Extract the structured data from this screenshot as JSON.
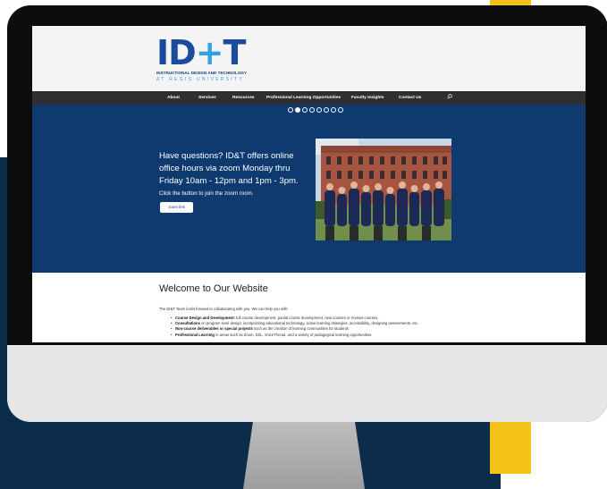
{
  "site": {
    "logo": {
      "mark_left": "ID",
      "mark_plus": "+",
      "mark_right": "T",
      "line1": "INSTRUCTIONAL DESIGN AND TECHNOLOGY",
      "line2": "AT REGIS UNIVERSITY"
    },
    "nav": {
      "items": [
        "About",
        "Services",
        "Resources",
        "Professional Learning Opportunities",
        "Faculty Insights",
        "Contact Us"
      ],
      "search_icon": "search-icon"
    },
    "hero": {
      "slide_count": 8,
      "active_slide": 2,
      "heading": "Have questions? ID&T offers online office hours via zoom Monday thru Friday 10am - 12pm and 1pm - 3pm.",
      "subtext": "Click the button to join the zoom room.",
      "button_label": "zoom link"
    },
    "content": {
      "title": "Welcome to Our Website",
      "intro": "The ID&T Team looks forward to collaborating with you. We can help you with:",
      "bullets": [
        {
          "bold": "Course Design and Development:",
          "text": " full course development, partial course development, new courses or revised courses."
        },
        {
          "bold": "Consultations",
          "text": " on program level design, incorporating educational technology, active learning strategies, accessibility, designing assessments, etc."
        },
        {
          "bold": "Non-course deliverables or special projects",
          "text": " such as the creation of learning communities for students"
        },
        {
          "bold": "Professional Learning",
          "text": " in areas such as Zoom, D2L, VoiceThread, and a variety of pedagogical learning opportunities."
        }
      ]
    }
  },
  "colors": {
    "navy_backdrop": "#0b2d4b",
    "yellow_accent": "#f5c318",
    "hero_blue": "#0f3a70",
    "nav_dark": "#2f2f2f",
    "logo_blue": "#1b4b9a",
    "logo_light_blue": "#2ea3df"
  }
}
